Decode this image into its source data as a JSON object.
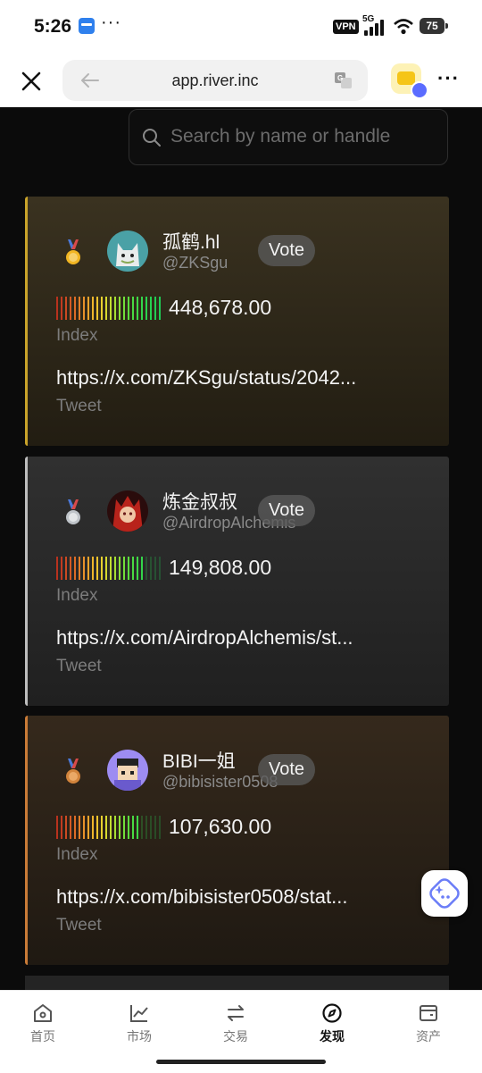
{
  "status_bar": {
    "time": "5:26",
    "app_icon": "wallet-app-icon",
    "overflow": "···",
    "vpn": "VPN",
    "network": "5G",
    "battery": "75"
  },
  "browser": {
    "url": "app.river.inc",
    "close_icon": "close-icon",
    "back_icon": "back-arrow-icon",
    "translate_icon": "translate-icon",
    "wallet_icon": "wallet-icon",
    "more": "···"
  },
  "search": {
    "placeholder": "Search by name or handle"
  },
  "cards": [
    {
      "rank": 1,
      "medal": "gold-medal-icon",
      "name": "孤鹤.hl",
      "handle": "@ZKSgu",
      "vote": "Vote",
      "index_value": "448,678.00",
      "index_label": "Index",
      "tweet_url": "https://x.com/ZKSgu/status/2042...",
      "tweet_label": "Tweet",
      "meter_level": 1.0,
      "accent": "#c9a32a"
    },
    {
      "rank": 2,
      "medal": "silver-medal-icon",
      "name": "炼金叔叔",
      "handle": "@AirdropAlchemis",
      "vote": "Vote",
      "index_value": "149,808.00",
      "index_label": "Index",
      "tweet_url": "https://x.com/AirdropAlchemis/st...",
      "tweet_label": "Tweet",
      "meter_level": 0.85,
      "accent": "#bdbdbd"
    },
    {
      "rank": 3,
      "medal": "bronze-medal-icon",
      "name": "BIBI一姐",
      "handle": "@bibisister0508",
      "vote": "Vote",
      "index_value": "107,630.00",
      "index_label": "Index",
      "tweet_url": "https://x.com/bibisister0508/stat...",
      "tweet_label": "Tweet",
      "meter_level": 0.8,
      "accent": "#c97b37"
    }
  ],
  "floating_button": "ai-sparkle-icon",
  "bottom_nav": [
    {
      "label": "首页",
      "icon": "home-icon",
      "active": false
    },
    {
      "label": "市场",
      "icon": "chart-icon",
      "active": false
    },
    {
      "label": "交易",
      "icon": "exchange-icon",
      "active": false
    },
    {
      "label": "发现",
      "icon": "discover-icon",
      "active": true
    },
    {
      "label": "资产",
      "icon": "wallet-icon",
      "active": false
    }
  ]
}
